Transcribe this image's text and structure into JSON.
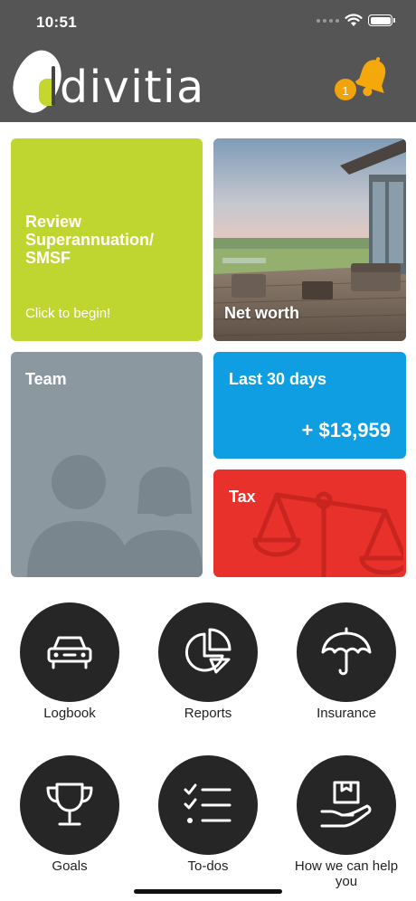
{
  "status_bar": {
    "time": "10:51"
  },
  "header": {
    "logo_text": "divitia",
    "notification_count": "1",
    "colors": {
      "background": "#555555",
      "badge": "#f0a30a",
      "bell": "#f5a80b"
    }
  },
  "tiles": {
    "review": {
      "title": "Review Superannuation/ SMSF",
      "subtitle": "Click to begin!",
      "color": "#c0d630"
    },
    "net_worth": {
      "title": "Net worth"
    },
    "team": {
      "title": "Team",
      "color": "#8b98a0"
    },
    "last_30_days": {
      "title": "Last 30 days",
      "amount": "+ $13,959",
      "color": "#0f9ee1"
    },
    "tax": {
      "title": "Tax",
      "color": "#e8312a"
    }
  },
  "actions": [
    {
      "label": "Logbook",
      "icon": "car-icon"
    },
    {
      "label": "Reports",
      "icon": "pie-chart-icon"
    },
    {
      "label": "Insurance",
      "icon": "umbrella-icon"
    },
    {
      "label": "Goals",
      "icon": "trophy-icon"
    },
    {
      "label": "To-dos",
      "icon": "checklist-icon"
    },
    {
      "label": "How we can help you",
      "icon": "hand-box-icon"
    }
  ]
}
